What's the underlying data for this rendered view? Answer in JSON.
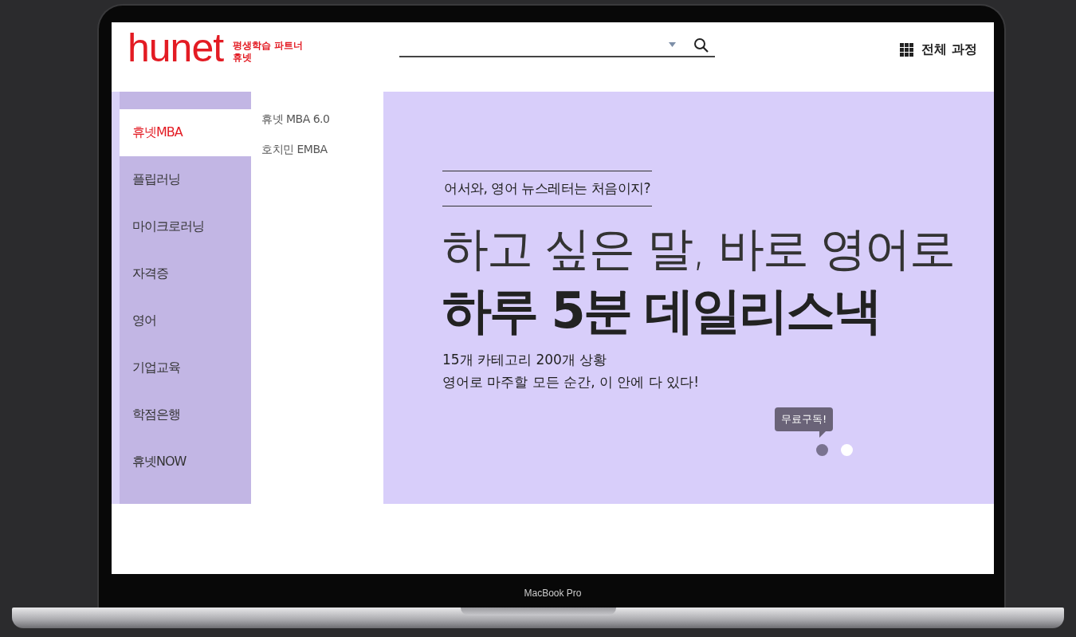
{
  "logo": {
    "wordmark": "hunet",
    "tagline_lines": [
      "평생학습 파트너",
      "휴넷"
    ]
  },
  "all_courses": {
    "label": "전체 과정"
  },
  "sidebar": {
    "items": [
      {
        "label": "휴넷MBA",
        "selected": true
      },
      {
        "label": "플립러닝",
        "selected": false
      },
      {
        "label": "마이크로러닝",
        "selected": false
      },
      {
        "label": "자격증",
        "selected": false
      },
      {
        "label": "영어",
        "selected": false
      },
      {
        "label": "기업교육",
        "selected": false
      },
      {
        "label": "학점은행",
        "selected": false
      },
      {
        "label": "휴넷NOW",
        "selected": false
      }
    ]
  },
  "submenu": {
    "items": [
      "휴넷 MBA 6.0",
      "호치민 EMBA"
    ]
  },
  "banner": {
    "tagline": "어서와, 영어 뉴스레터는 처음이지?",
    "headline": "하고 싶은 말, 바로 영어로",
    "headline_bold": "하루 5분 데일리스낵",
    "description_lines": [
      "15개 카테고리 200개 상황",
      "영어로 마주할 모든 순간, 이 안에 다 있다!"
    ],
    "tooltip": "무료구독!",
    "dots": [
      {
        "selected": true
      },
      {
        "selected": false
      }
    ]
  },
  "device_label": "MacBook Pro"
}
